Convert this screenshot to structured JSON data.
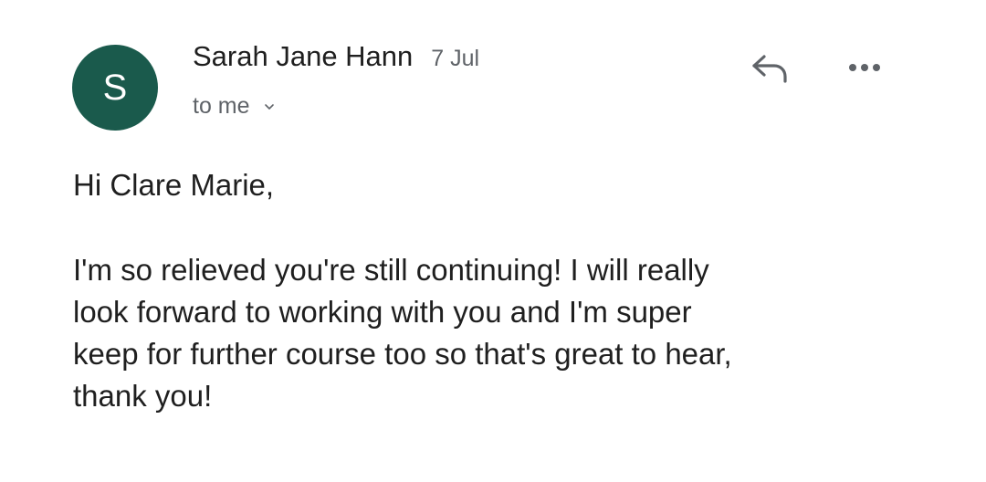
{
  "email": {
    "sender": {
      "avatar_initial": "S",
      "avatar_color": "#1a5a4c",
      "name": "Sarah Jane Hann",
      "date": "7 Jul"
    },
    "recipient_label": "to me",
    "actions": {
      "reply_icon": "reply-icon",
      "more_icon": "more-horizontal-icon"
    },
    "body": {
      "greeting": "Hi Clare Marie,",
      "lines": [
        "I'm so relieved you're still continuing! I will really",
        "look forward to working with you and I'm super",
        "keep for further course too so that's great to hear,",
        "thank you!"
      ]
    }
  }
}
